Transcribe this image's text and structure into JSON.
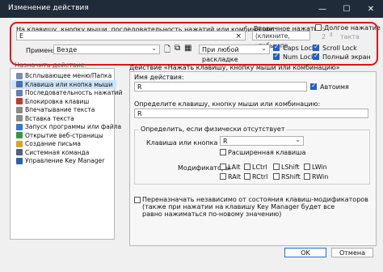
{
  "window": {
    "title": "Изменение действия",
    "minimize": "—",
    "maximize": "☐",
    "close": "✕"
  },
  "top": {
    "main_label": "На клавишу, кнопку мыши, последовательность нажатий или комбинацию:",
    "key_value": "E",
    "clear_glyph": "×",
    "secondary_label": "Вторичное нажатие:",
    "secondary_placeholder": "(кликните, чтобы опр",
    "long_press_label": "Долгое нажатие",
    "seconds_value": "2",
    "seconds_unit": "такта",
    "apply_label": "Применять",
    "apply_value": "Везде",
    "layout_value": "При любой раскладке",
    "caps_lock": "Caps Lock",
    "num_lock": "Num Lock",
    "scroll_lock": "Scroll Lock",
    "fullscreen": "Полный экран"
  },
  "left": {
    "header": "Назначить действие:",
    "items": [
      {
        "label": "Всплывающее меню/Папка",
        "color": "#7a8fb0"
      },
      {
        "label": "Клавиша или кнопка мыши",
        "color": "#4a6fb5"
      },
      {
        "label": "Последовательность нажатий",
        "color": "#5f7fb8"
      },
      {
        "label": "Блокировка клавиш",
        "color": "#c23a2b"
      },
      {
        "label": "Впечатывание текста",
        "color": "#8a8a8a"
      },
      {
        "label": "Вставка текста",
        "color": "#8a8a8a"
      },
      {
        "label": "Запуск программы или файла",
        "color": "#2e7ad1"
      },
      {
        "label": "Открытие веб-страницы",
        "color": "#2f9a3e"
      },
      {
        "label": "Создание письма",
        "color": "#d9a520"
      },
      {
        "label": "Системная команда",
        "color": "#4c5f8a"
      },
      {
        "label": "Управление Key Manager",
        "color": "#2e5fb0"
      }
    ]
  },
  "right": {
    "header": "Действие «Нажать клавишу, кнопку мыши или комбинацию»",
    "name_label": "Имя действия:",
    "name_value": "R",
    "auto_label": "Автоимя",
    "define_label": "Определите клавишу, кнопку мыши или комбинацию:",
    "define_value": "R",
    "physical_label": "Определить, если физически отсутствует",
    "key_label": "Клавиша или кнопка мыши",
    "key_value": "R",
    "extended_label": "Расширенная клавиша",
    "modifiers_label": "Модификаторы",
    "modifiers": [
      "LAlt",
      "LCtrl",
      "LShift",
      "LWin",
      "RAlt",
      "RCtrl",
      "RShift",
      "RWin"
    ],
    "reassign_line1": "Переназначать независимо от состояния клавиш-модификаторов",
    "reassign_line2": "(также при нажатии на клавишу Key Manager будет все",
    "reassign_line3": "равно нажиматься по-новому значению)"
  },
  "footer": {
    "ok": "OK",
    "cancel": "Отмена"
  }
}
